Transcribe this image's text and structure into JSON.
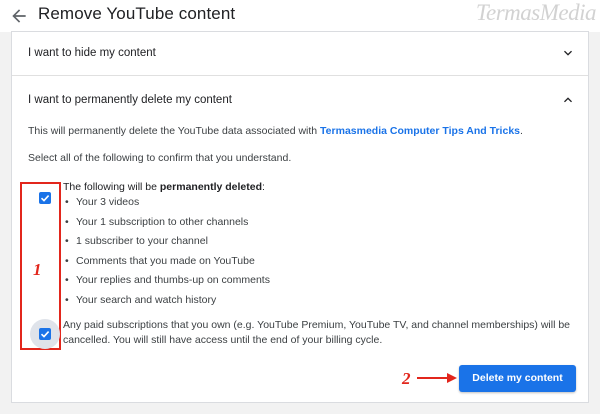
{
  "header": {
    "title": "Remove YouTube content",
    "watermark": "TermasMedia"
  },
  "sections": {
    "hide": {
      "label": "I want to hide my content",
      "expanded": false
    },
    "delete": {
      "label": "I want to permanently delete my content",
      "expanded": true
    }
  },
  "delete_panel": {
    "intro_prefix": "This will permanently delete the YouTube data associated with ",
    "channel_name": "Termasmedia Computer Tips And Tricks",
    "intro_suffix": ".",
    "confirm_instruction": "Select all of the following to confirm that you understand.",
    "list_intro_prefix": "The following will be ",
    "list_intro_bold": "permanently deleted",
    "list_intro_suffix": ":",
    "items": [
      "Your 3 videos",
      "Your 1 subscription to other channels",
      "1 subscriber to your channel",
      "Comments that you made on YouTube",
      "Your replies and thumbs-up on comments",
      "Your search and watch history"
    ],
    "paid_notice": "Any paid subscriptions that you own (e.g. YouTube Premium, YouTube TV, and channel memberships) will be cancelled. You will still have access until the end of your billing cycle.",
    "checkbox_deleted_checked": true,
    "checkbox_paid_checked": true,
    "delete_button_label": "Delete my content"
  },
  "annotations": {
    "callout_1": "1",
    "callout_2": "2",
    "highlight_color": "#e2261c"
  },
  "colors": {
    "accent": "#1a73e8",
    "background": "#f2f2f2",
    "card": "#ffffff"
  },
  "icons": {
    "back": "arrow-left-icon",
    "collapsed": "chevron-down-icon",
    "expanded": "chevron-up-icon",
    "check": "check-icon"
  }
}
